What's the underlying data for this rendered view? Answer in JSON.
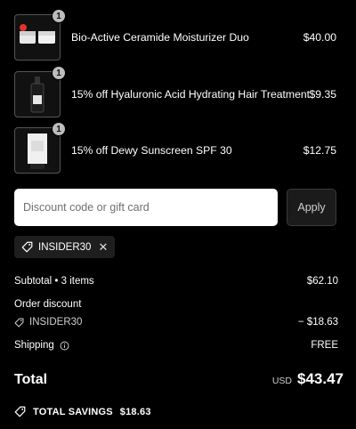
{
  "cart": {
    "items": [
      {
        "name": "Bio-Active Ceramide Moisturizer Duo",
        "price": "$40.00",
        "quantity": "1",
        "image_icon": "moisturizer-jars-icon"
      },
      {
        "name": "15% off Hyaluronic Acid Hydrating Hair Treatment",
        "price": "$9.35",
        "quantity": "1",
        "image_icon": "dropper-bottle-icon"
      },
      {
        "name": "15% off Dewy Sunscreen SPF 30",
        "price": "$12.75",
        "quantity": "1",
        "image_icon": "sunscreen-tube-icon"
      }
    ]
  },
  "discount": {
    "placeholder": "Discount code or gift card",
    "apply_label": "Apply",
    "applied_code": "INSIDER30"
  },
  "summary": {
    "subtotal_label": "Subtotal • 3 items",
    "subtotal_value": "$62.10",
    "order_discount_label": "Order discount",
    "order_discount_code": "INSIDER30",
    "order_discount_value": "− $18.63",
    "shipping_label": "Shipping",
    "shipping_value": "FREE",
    "total_label": "Total",
    "currency": "USD",
    "total_value": "$43.47",
    "savings_label": "TOTAL SAVINGS",
    "savings_value": "$18.63"
  },
  "colors": {
    "background": "#000000",
    "badge": "#bdbdbd",
    "accent_red": "#e0342c"
  }
}
